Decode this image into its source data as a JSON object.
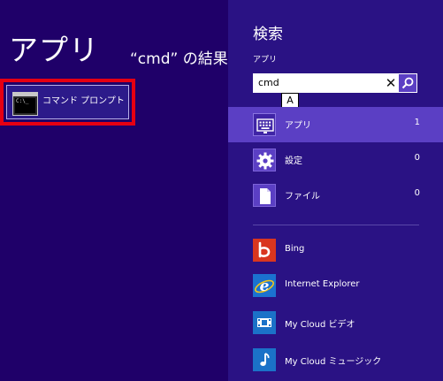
{
  "results": {
    "title": "アプリ",
    "subtitle": "“cmd” の結果",
    "items": [
      {
        "label": "コマンド プロンプト",
        "icon": "command-prompt-icon"
      }
    ]
  },
  "search_pane": {
    "title": "検索",
    "scope": "アプリ",
    "query": "cmd",
    "clear_glyph": "✕",
    "callout": "A",
    "categories": [
      {
        "label": "アプリ",
        "count": "1",
        "icon": "apps-keyboard-icon",
        "selected": true
      },
      {
        "label": "設定",
        "count": "0",
        "icon": "settings-gear-icon",
        "selected": false
      },
      {
        "label": "ファイル",
        "count": "0",
        "icon": "file-icon",
        "selected": false
      }
    ],
    "apps": [
      {
        "label": "Bing",
        "icon": "bing-icon",
        "color": "#d9361f"
      },
      {
        "label": "Internet Explorer",
        "icon": "internet-explorer-icon",
        "color": "#1b72d0"
      },
      {
        "label": "My Cloud ビデオ",
        "icon": "video-icon",
        "color": "#1b72c8"
      },
      {
        "label": "My Cloud ミュージック",
        "icon": "music-icon",
        "color": "#1b72c8"
      }
    ]
  },
  "colors": {
    "background": "#1f0069",
    "charm": "#2a1284",
    "accent": "#5b3fc4",
    "highlight_border": "#e60012"
  }
}
